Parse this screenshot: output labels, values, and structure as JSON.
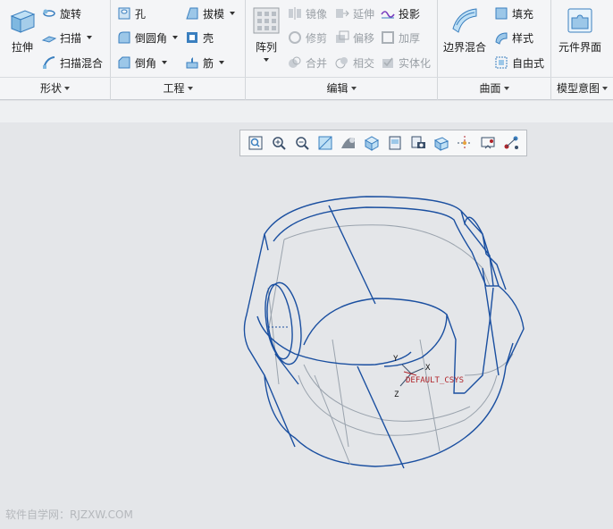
{
  "ribbon": {
    "shape": {
      "extrude_label": "拉伸",
      "revolve_label": "旋转",
      "sweep_label": "扫描",
      "swept_blend_label": "扫描混合",
      "group_label": "形状"
    },
    "engineering": {
      "hole_label": "孔",
      "draft_label": "拔模",
      "round_label": "倒圆角",
      "shell_label": "壳",
      "chamfer_label": "倒角",
      "rib_label": "筋",
      "group_label": "工程"
    },
    "editing": {
      "pattern_label": "阵列",
      "mirror_label": "镜像",
      "extend_label": "延伸",
      "project_label": "投影",
      "trim_label": "修剪",
      "offset_label": "偏移",
      "thicken_label": "加厚",
      "merge_label": "合并",
      "intersect_label": "相交",
      "solidify_label": "实体化",
      "group_label": "编辑"
    },
    "surfaces": {
      "boundary_blend_label": "边界混合",
      "fill_label": "填充",
      "style_label": "样式",
      "freestyle_label": "自由式",
      "group_label": "曲面"
    },
    "model_intent": {
      "component_interface_label": "元件界面",
      "group_label": "模型意图"
    }
  },
  "view_toolbar": {
    "icons": [
      "zoom-fit-icon",
      "zoom-in-icon",
      "zoom-out-icon",
      "repaint-icon",
      "display-style-icon",
      "saved-orientations-icon",
      "named-views-icon",
      "view-manager-icon",
      "perspective-icon",
      "datum-display-icon",
      "spin-center-icon",
      "annotation-display-icon"
    ]
  },
  "model": {
    "csys_label": "DEFAULT_CSYS",
    "axis_x": "X",
    "axis_y": "Y",
    "axis_z": "Z"
  },
  "watermark": "软件自学网：RJZXW.COM",
  "colors": {
    "ribbon_bg": "#f4f5f7",
    "canvas_bg": "#e4e6e9",
    "edge_blue": "#1a4fa0",
    "hidden_edge": "#9aa3ad",
    "csys_red": "#b0242a"
  }
}
